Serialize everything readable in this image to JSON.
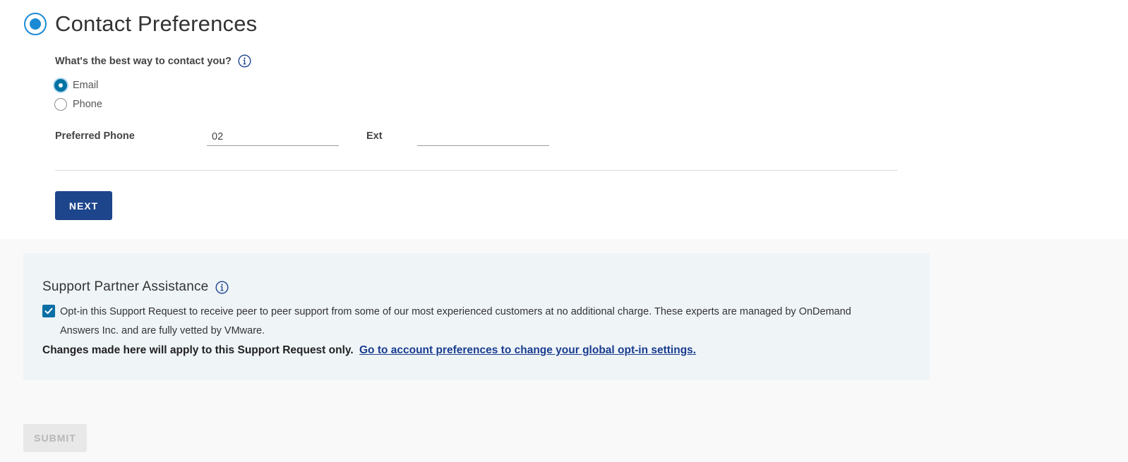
{
  "step": {
    "title": "Contact Preferences"
  },
  "contact": {
    "question": "What's the best way to contact you?",
    "options": [
      {
        "label": "Email",
        "checked": true
      },
      {
        "label": "Phone",
        "checked": false
      }
    ],
    "phone_label": "Preferred Phone",
    "phone_value": "02",
    "ext_label": "Ext",
    "ext_value": "",
    "next_label": "NEXT"
  },
  "partner": {
    "title": "Support Partner Assistance",
    "optin_checked": true,
    "optin_text": "Opt-in this Support Request to receive peer to peer support from some of our most experienced customers at no additional charge. These experts are managed by OnDemand Answers Inc. and are fully vetted by VMware.",
    "changes_text": "Changes made here will apply to this Support Request only.",
    "link_text": "Go to account preferences to change your global opt-in settings."
  },
  "submit_label": "SUBMIT",
  "colors": {
    "accent": "#1b8ad4",
    "button_primary": "#1c458c",
    "link": "#1a3d8f",
    "partner_bg": "#eff4f7"
  },
  "icons": [
    "step-indicator-icon",
    "info-icon",
    "checkmark-icon"
  ]
}
